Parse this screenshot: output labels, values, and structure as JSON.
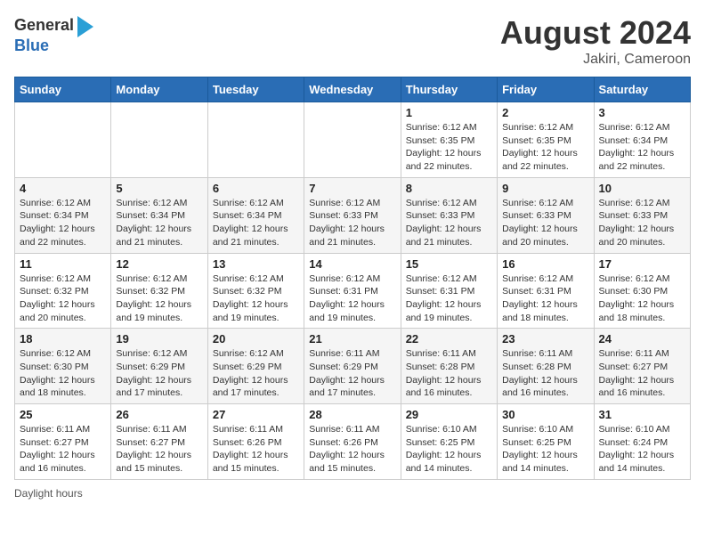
{
  "header": {
    "logo_line1": "General",
    "logo_line2": "Blue",
    "month_year": "August 2024",
    "location": "Jakiri, Cameroon"
  },
  "weekdays": [
    "Sunday",
    "Monday",
    "Tuesday",
    "Wednesday",
    "Thursday",
    "Friday",
    "Saturday"
  ],
  "weeks": [
    [
      {
        "day": "",
        "info": ""
      },
      {
        "day": "",
        "info": ""
      },
      {
        "day": "",
        "info": ""
      },
      {
        "day": "",
        "info": ""
      },
      {
        "day": "1",
        "info": "Sunrise: 6:12 AM\nSunset: 6:35 PM\nDaylight: 12 hours and 22 minutes."
      },
      {
        "day": "2",
        "info": "Sunrise: 6:12 AM\nSunset: 6:35 PM\nDaylight: 12 hours and 22 minutes."
      },
      {
        "day": "3",
        "info": "Sunrise: 6:12 AM\nSunset: 6:34 PM\nDaylight: 12 hours and 22 minutes."
      }
    ],
    [
      {
        "day": "4",
        "info": "Sunrise: 6:12 AM\nSunset: 6:34 PM\nDaylight: 12 hours and 22 minutes."
      },
      {
        "day": "5",
        "info": "Sunrise: 6:12 AM\nSunset: 6:34 PM\nDaylight: 12 hours and 21 minutes."
      },
      {
        "day": "6",
        "info": "Sunrise: 6:12 AM\nSunset: 6:34 PM\nDaylight: 12 hours and 21 minutes."
      },
      {
        "day": "7",
        "info": "Sunrise: 6:12 AM\nSunset: 6:33 PM\nDaylight: 12 hours and 21 minutes."
      },
      {
        "day": "8",
        "info": "Sunrise: 6:12 AM\nSunset: 6:33 PM\nDaylight: 12 hours and 21 minutes."
      },
      {
        "day": "9",
        "info": "Sunrise: 6:12 AM\nSunset: 6:33 PM\nDaylight: 12 hours and 20 minutes."
      },
      {
        "day": "10",
        "info": "Sunrise: 6:12 AM\nSunset: 6:33 PM\nDaylight: 12 hours and 20 minutes."
      }
    ],
    [
      {
        "day": "11",
        "info": "Sunrise: 6:12 AM\nSunset: 6:32 PM\nDaylight: 12 hours and 20 minutes."
      },
      {
        "day": "12",
        "info": "Sunrise: 6:12 AM\nSunset: 6:32 PM\nDaylight: 12 hours and 19 minutes."
      },
      {
        "day": "13",
        "info": "Sunrise: 6:12 AM\nSunset: 6:32 PM\nDaylight: 12 hours and 19 minutes."
      },
      {
        "day": "14",
        "info": "Sunrise: 6:12 AM\nSunset: 6:31 PM\nDaylight: 12 hours and 19 minutes."
      },
      {
        "day": "15",
        "info": "Sunrise: 6:12 AM\nSunset: 6:31 PM\nDaylight: 12 hours and 19 minutes."
      },
      {
        "day": "16",
        "info": "Sunrise: 6:12 AM\nSunset: 6:31 PM\nDaylight: 12 hours and 18 minutes."
      },
      {
        "day": "17",
        "info": "Sunrise: 6:12 AM\nSunset: 6:30 PM\nDaylight: 12 hours and 18 minutes."
      }
    ],
    [
      {
        "day": "18",
        "info": "Sunrise: 6:12 AM\nSunset: 6:30 PM\nDaylight: 12 hours and 18 minutes."
      },
      {
        "day": "19",
        "info": "Sunrise: 6:12 AM\nSunset: 6:29 PM\nDaylight: 12 hours and 17 minutes."
      },
      {
        "day": "20",
        "info": "Sunrise: 6:12 AM\nSunset: 6:29 PM\nDaylight: 12 hours and 17 minutes."
      },
      {
        "day": "21",
        "info": "Sunrise: 6:11 AM\nSunset: 6:29 PM\nDaylight: 12 hours and 17 minutes."
      },
      {
        "day": "22",
        "info": "Sunrise: 6:11 AM\nSunset: 6:28 PM\nDaylight: 12 hours and 16 minutes."
      },
      {
        "day": "23",
        "info": "Sunrise: 6:11 AM\nSunset: 6:28 PM\nDaylight: 12 hours and 16 minutes."
      },
      {
        "day": "24",
        "info": "Sunrise: 6:11 AM\nSunset: 6:27 PM\nDaylight: 12 hours and 16 minutes."
      }
    ],
    [
      {
        "day": "25",
        "info": "Sunrise: 6:11 AM\nSunset: 6:27 PM\nDaylight: 12 hours and 16 minutes."
      },
      {
        "day": "26",
        "info": "Sunrise: 6:11 AM\nSunset: 6:27 PM\nDaylight: 12 hours and 15 minutes."
      },
      {
        "day": "27",
        "info": "Sunrise: 6:11 AM\nSunset: 6:26 PM\nDaylight: 12 hours and 15 minutes."
      },
      {
        "day": "28",
        "info": "Sunrise: 6:11 AM\nSunset: 6:26 PM\nDaylight: 12 hours and 15 minutes."
      },
      {
        "day": "29",
        "info": "Sunrise: 6:10 AM\nSunset: 6:25 PM\nDaylight: 12 hours and 14 minutes."
      },
      {
        "day": "30",
        "info": "Sunrise: 6:10 AM\nSunset: 6:25 PM\nDaylight: 12 hours and 14 minutes."
      },
      {
        "day": "31",
        "info": "Sunrise: 6:10 AM\nSunset: 6:24 PM\nDaylight: 12 hours and 14 minutes."
      }
    ]
  ],
  "legend": {
    "daylight_label": "Daylight hours"
  }
}
